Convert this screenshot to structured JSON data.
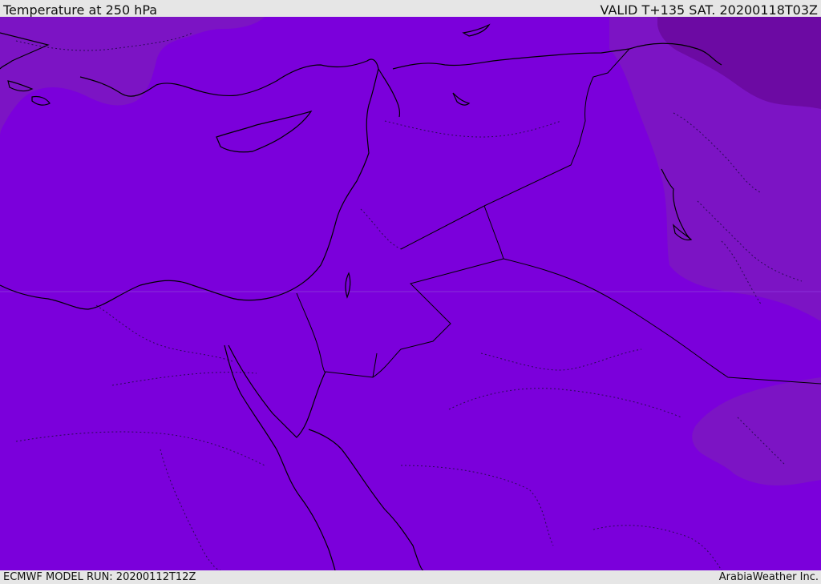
{
  "header": {
    "title": "Temperature at 250 hPa",
    "valid_time": "VALID T+135 SAT. 20200118T03Z"
  },
  "footer": {
    "model_run": "ECMWF MODEL RUN: 20200112T12Z",
    "credit": "ArabiaWeather Inc."
  },
  "map": {
    "colors": {
      "base_fill": "#7b00db",
      "slightly_colder": "#7c14c4",
      "colder": "#6c0aa3",
      "coastline": "#000000",
      "border": "#2a0a55"
    }
  }
}
